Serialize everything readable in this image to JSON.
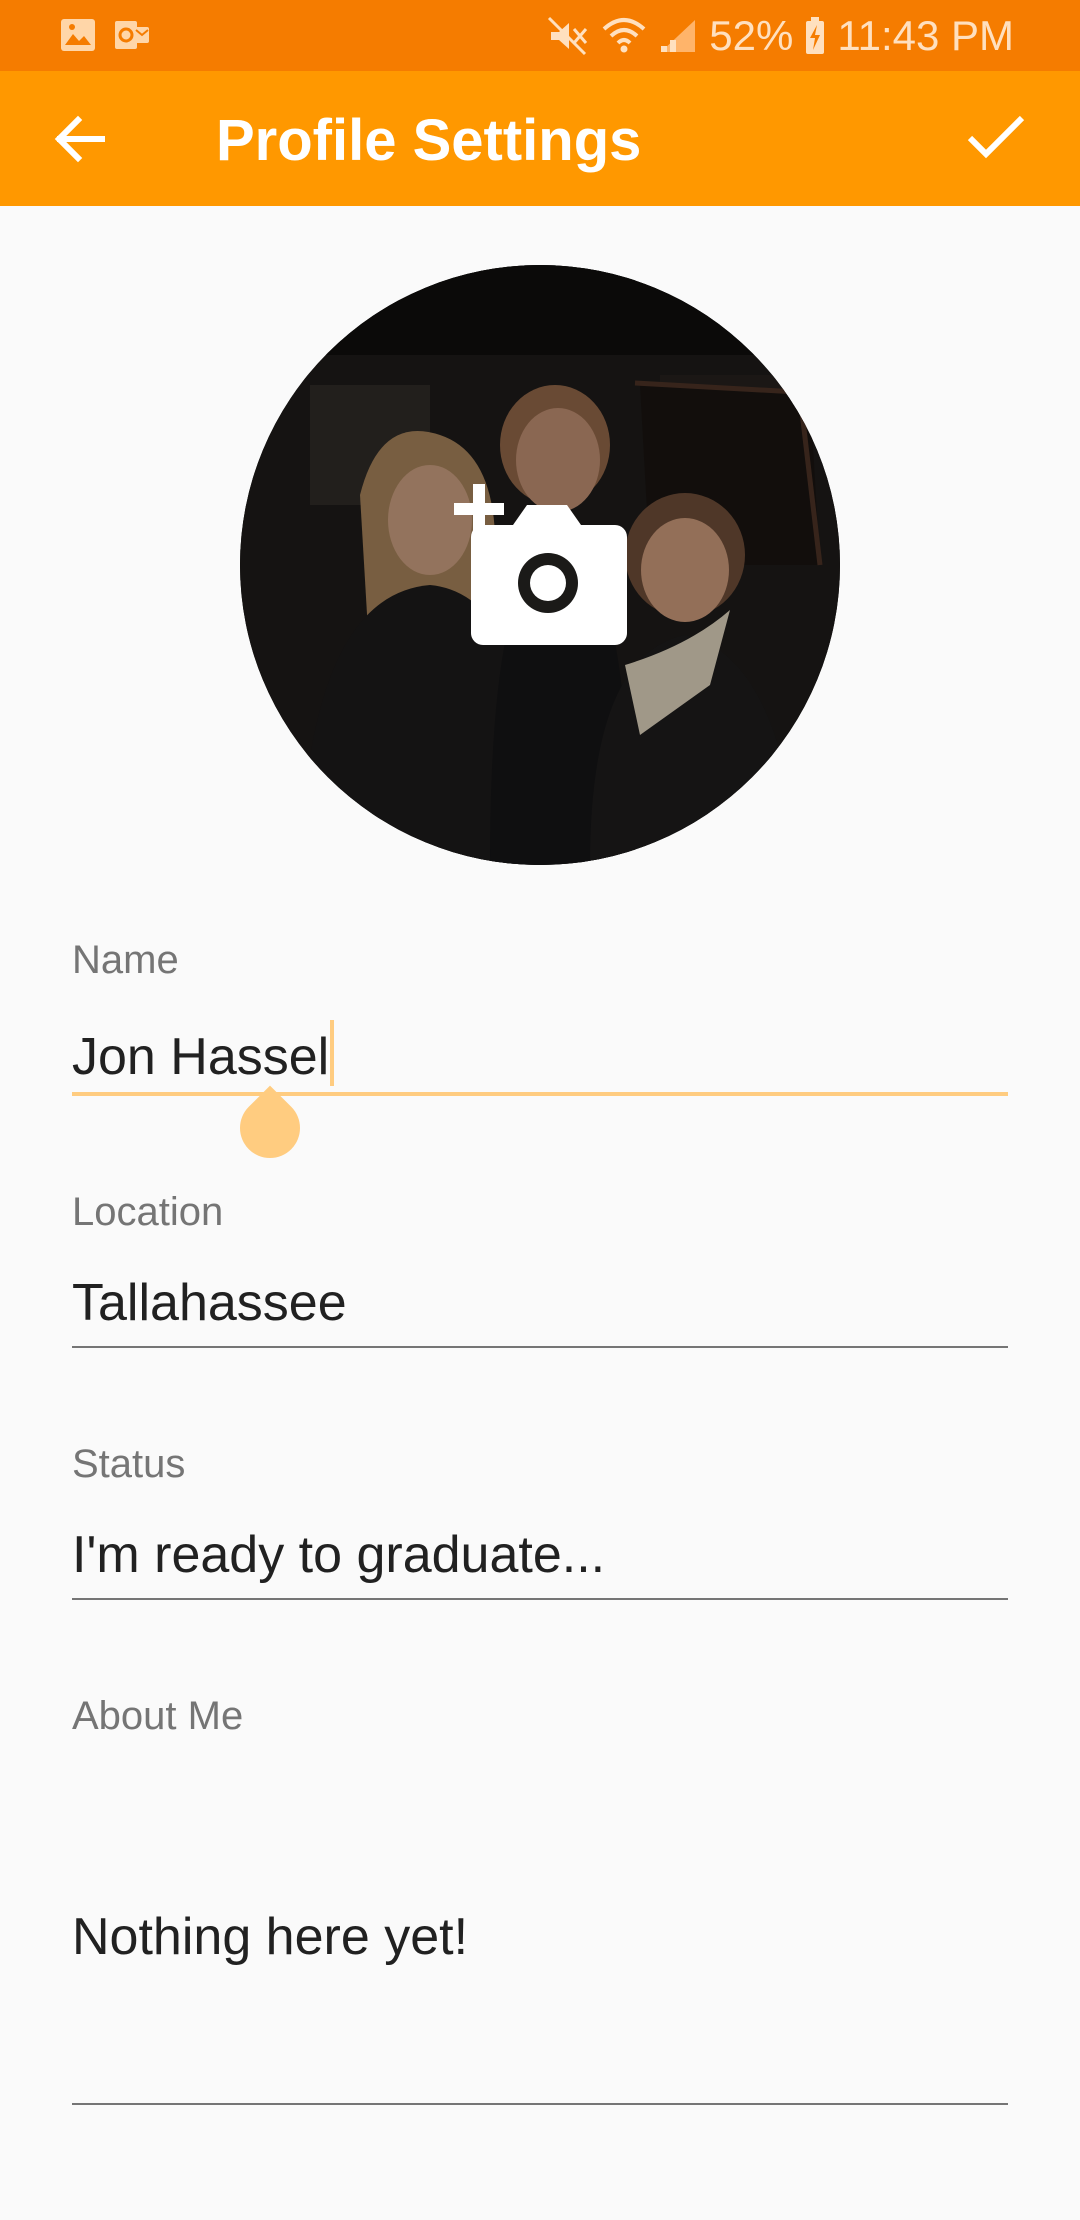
{
  "status_bar": {
    "battery_percent": "52%",
    "time": "11:43 PM",
    "icons": [
      "gallery-icon",
      "outlook-icon",
      "mute-icon",
      "wifi-icon",
      "signal-icon",
      "battery-charging-icon"
    ],
    "background": "#f57c00"
  },
  "app_bar": {
    "title": "Profile Settings",
    "back_icon": "arrow-back-icon",
    "confirm_icon": "check-icon",
    "background": "#ff9800"
  },
  "profile_photo": {
    "change_photo_icon": "add-photo-camera-icon"
  },
  "form": {
    "name": {
      "label": "Name",
      "value": "Jon Hassel"
    },
    "location": {
      "label": "Location",
      "value": "Tallahassee"
    },
    "status": {
      "label": "Status",
      "value": "I'm ready to graduate..."
    },
    "about_me": {
      "label": "About Me",
      "value": "Nothing here yet!"
    }
  },
  "colors": {
    "accent": "#ff9800",
    "active_underline": "#ffcc80"
  }
}
